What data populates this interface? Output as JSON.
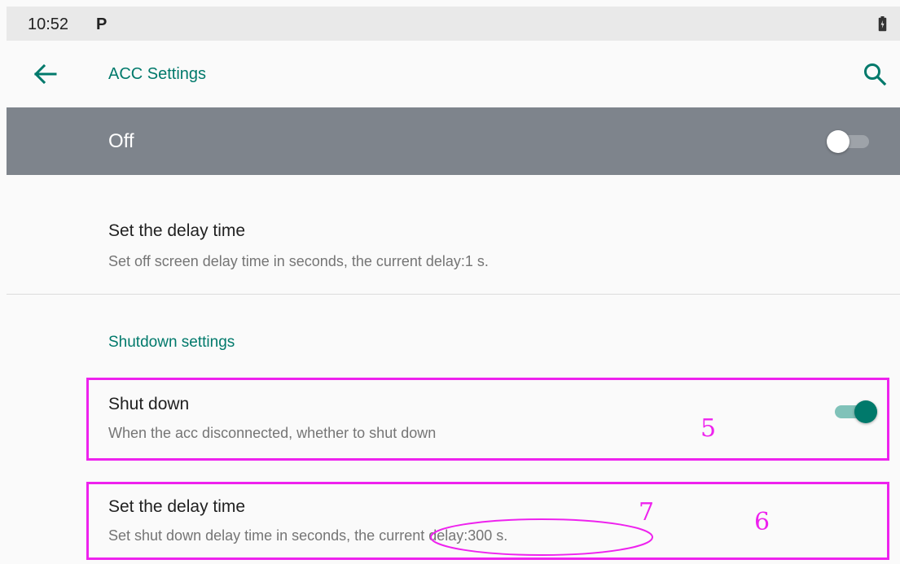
{
  "status_bar": {
    "time": "10:52",
    "app_icon": "P",
    "battery_icon": "battery-icon"
  },
  "app_bar": {
    "back_icon": "arrow-left-icon",
    "title": "ACC Settings",
    "search_icon": "search-icon"
  },
  "master_switch": {
    "label": "Off",
    "checked": false
  },
  "screen_off_delay": {
    "title": "Set the delay time",
    "summary": "Set off screen delay time in seconds, the current delay:1 s."
  },
  "shutdown_category": {
    "title": "Shutdown settings"
  },
  "shut_down": {
    "title": "Shut down",
    "summary": "When the acc disconnected, whether to shut down",
    "checked": true
  },
  "shutdown_delay": {
    "title": "Set the delay time",
    "summary_prefix": "Set shut down delay time in seconds,",
    "summary_current": " the current delay:300 s."
  },
  "annotations": {
    "label_5": "5",
    "label_6": "6",
    "label_7": "7"
  },
  "colors": {
    "accent": "#00796b",
    "master_bar": "#7e848c",
    "annotation": "#ee22ee"
  }
}
